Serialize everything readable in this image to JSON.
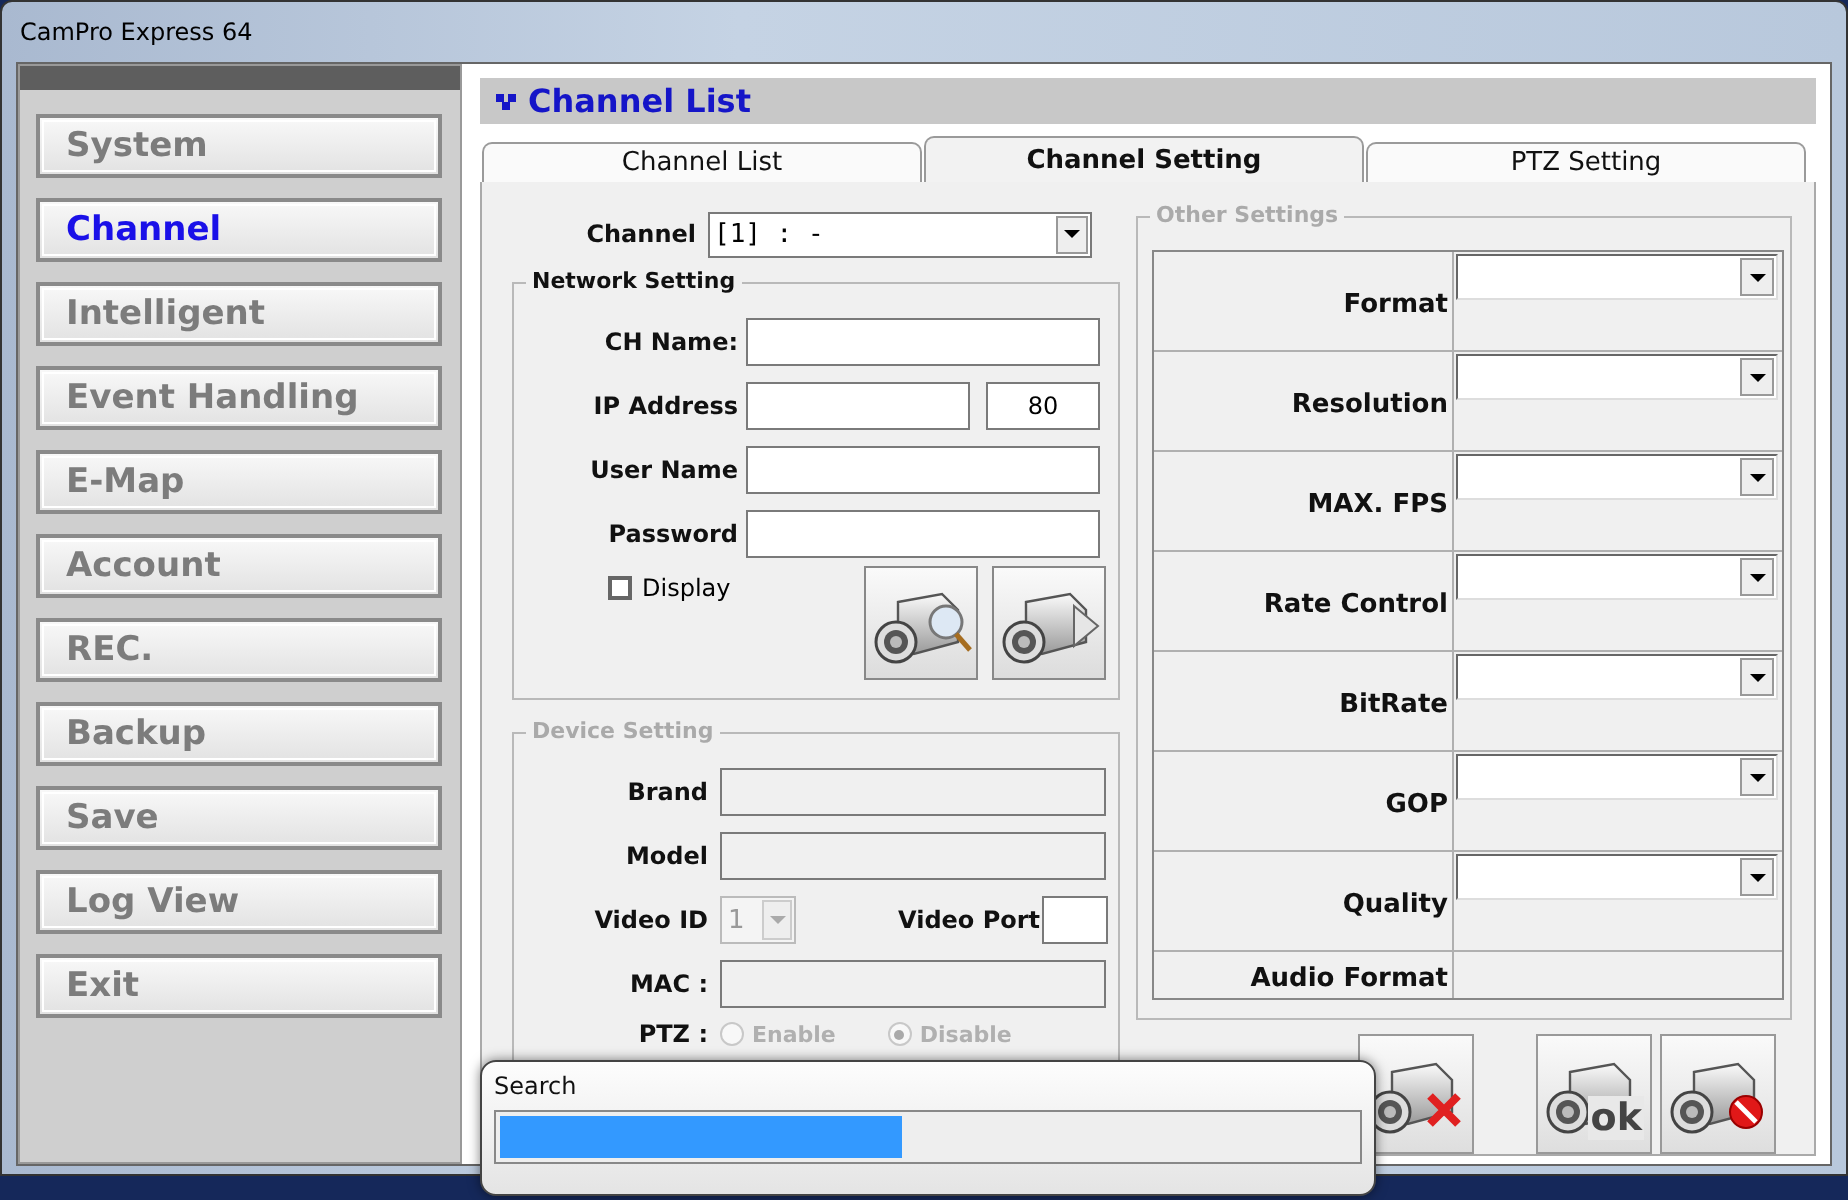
{
  "window": {
    "title": "CamPro Express 64"
  },
  "sidebar": {
    "items": [
      {
        "label": "System",
        "selected": false
      },
      {
        "label": "Channel",
        "selected": true
      },
      {
        "label": "Intelligent",
        "selected": false
      },
      {
        "label": "Event Handling",
        "selected": false
      },
      {
        "label": "E-Map",
        "selected": false
      },
      {
        "label": "Account",
        "selected": false
      },
      {
        "label": "REC.",
        "selected": false
      },
      {
        "label": "Backup",
        "selected": false
      },
      {
        "label": "Save",
        "selected": false
      },
      {
        "label": "Log View",
        "selected": false
      },
      {
        "label": "Exit",
        "selected": false
      }
    ]
  },
  "header": {
    "title": "Channel List"
  },
  "tabs": [
    {
      "label": "Channel List",
      "selected": false
    },
    {
      "label": "Channel Setting",
      "selected": true
    },
    {
      "label": "PTZ Setting",
      "selected": false
    }
  ],
  "channel": {
    "label": "Channel",
    "value": "[1] : -"
  },
  "network_setting": {
    "title": "Network Setting",
    "fields": [
      {
        "label": "CH Name:"
      },
      {
        "label": "IP Address",
        "port": "80"
      },
      {
        "label": "User Name"
      },
      {
        "label": "Password"
      }
    ],
    "display": {
      "label": "Display",
      "checked": false
    },
    "buttons": [
      {
        "kind": "search"
      },
      {
        "kind": "apply"
      }
    ]
  },
  "device_setting": {
    "title": "Device Setting",
    "fields": [
      {
        "label": "Brand"
      },
      {
        "label": "Model"
      }
    ],
    "video_id": {
      "label": "Video ID",
      "value": "1"
    },
    "video_port": {
      "label": "Video Port"
    },
    "mac": {
      "label": "MAC :"
    },
    "ptz": {
      "label": "PTZ :",
      "disabled": true,
      "options": [
        {
          "label": "Enable",
          "selected": false
        },
        {
          "label": "Disable",
          "selected": true
        }
      ]
    }
  },
  "other_settings": {
    "title": "Other Settings",
    "rows": [
      {
        "label": "Format",
        "kind": "dropdown"
      },
      {
        "label": "Resolution",
        "kind": "dropdown"
      },
      {
        "label": "MAX. FPS",
        "kind": "dropdown"
      },
      {
        "label": "Rate Control",
        "kind": "dropdown"
      },
      {
        "label": "BitRate",
        "kind": "dropdown"
      },
      {
        "label": "GOP",
        "kind": "dropdown"
      },
      {
        "label": "Quality",
        "kind": "dropdown"
      },
      {
        "label": "Audio Format",
        "kind": "text"
      }
    ]
  },
  "action_buttons": [
    {
      "kind": "delete"
    },
    {
      "kind": "ok",
      "label": "ok"
    },
    {
      "kind": "cancel"
    }
  ],
  "search_dialog": {
    "title": "Search",
    "progress": {
      "level": 0.47
    }
  }
}
